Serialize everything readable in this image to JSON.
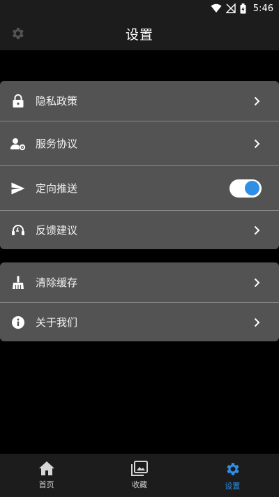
{
  "status_bar": {
    "time": "5:46"
  },
  "header": {
    "title": "设置"
  },
  "settings": {
    "group1": [
      {
        "label": "隐私政策",
        "icon": "lock-icon"
      },
      {
        "label": "服务协议",
        "icon": "user-settings-icon"
      },
      {
        "label": "定向推送",
        "icon": "send-icon",
        "toggle_on": true
      },
      {
        "label": "反馈建议",
        "icon": "support-icon"
      }
    ],
    "group2": [
      {
        "label": "清除缓存",
        "icon": "broom-icon"
      },
      {
        "label": "关于我们",
        "icon": "info-icon"
      }
    ]
  },
  "bottom_nav": [
    {
      "label": "首页",
      "icon": "home-icon",
      "active": false
    },
    {
      "label": "收藏",
      "icon": "collection-icon",
      "active": false
    },
    {
      "label": "设置",
      "icon": "gear-icon",
      "active": true
    }
  ],
  "colors": {
    "accent": "#2f8fe6",
    "card": "#535353",
    "bar": "#1c1c1c"
  }
}
